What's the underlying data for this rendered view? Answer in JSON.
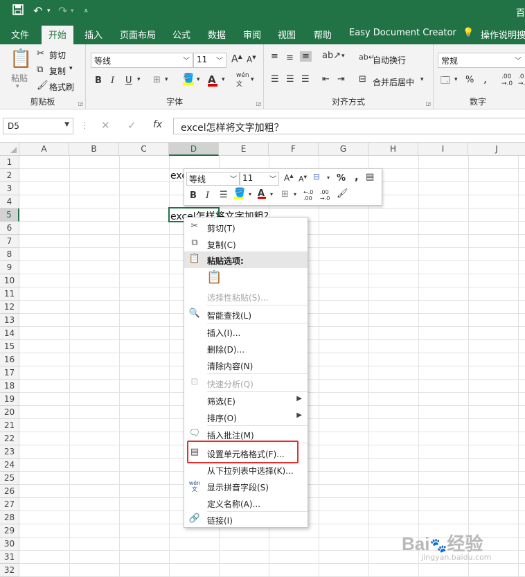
{
  "window": {
    "title_fragment": "百"
  },
  "quick_access": {
    "save": "save-icon",
    "undo": "undo-icon",
    "redo": "redo-icon",
    "customize": "customize-icon"
  },
  "ribbon_tabs": [
    "文件",
    "开始",
    "插入",
    "页面布局",
    "公式",
    "数据",
    "审阅",
    "视图",
    "帮助",
    "Easy Document Creator",
    "操作说明搜"
  ],
  "active_tab": "开始",
  "clipboard": {
    "paste": "粘贴",
    "cut": "剪切",
    "copy": "复制",
    "format_painter": "格式刷",
    "label": "剪贴板"
  },
  "font_group": {
    "font_name": "等线",
    "font_size": "11",
    "grow": "A",
    "shrink": "A",
    "bold": "B",
    "italic": "I",
    "underline": "U",
    "phonetic": "wén",
    "label": "字体"
  },
  "align_group": {
    "wrap_text": "自动换行",
    "merge_center": "合并后居中",
    "label": "对齐方式"
  },
  "number_group": {
    "format": "常规",
    "percent": "%",
    "comma": ",",
    "label": "数字"
  },
  "formula_bar": {
    "name_box": "D5",
    "fx": "fx",
    "formula": "excel怎样将文字加粗？"
  },
  "columns": [
    "A",
    "B",
    "C",
    "D",
    "E",
    "F",
    "G",
    "H",
    "I",
    "J"
  ],
  "rows": [
    "1",
    "2",
    "3",
    "4",
    "5",
    "6",
    "7",
    "8",
    "9",
    "10",
    "11",
    "12",
    "13",
    "14",
    "15",
    "16",
    "17",
    "18",
    "19",
    "20",
    "21",
    "22",
    "23",
    "24",
    "25",
    "26",
    "27",
    "28",
    "29",
    "30",
    "31",
    "32"
  ],
  "cells": {
    "d2": "exc",
    "d5": "excel怎样将文字加粗？"
  },
  "mini_toolbar": {
    "font_name": "等线",
    "font_size": "11",
    "bold": "B",
    "italic": "I",
    "percent": "%",
    "comma": ","
  },
  "context_menu": {
    "cut": "剪切(T)",
    "copy": "复制(C)",
    "paste_options": "粘贴选项:",
    "paste_special": "选择性粘贴(S)...",
    "smart_lookup": "智能查找(L)",
    "insert": "插入(I)...",
    "delete": "删除(D)...",
    "clear": "清除内容(N)",
    "quick_analysis": "快速分析(Q)",
    "filter": "筛选(E)",
    "sort": "排序(O)",
    "insert_comment": "插入批注(M)",
    "format_cells": "设置单元格格式(F)...",
    "pick_from_list": "从下拉列表中选择(K)...",
    "show_phonetic": "显示拼音字段(S)",
    "define_name": "定义名称(A)...",
    "link": "链接(I)"
  },
  "watermark": {
    "brand": "Bai",
    "brand2": "经验",
    "url": "jingyan.baidu.com"
  },
  "colors": {
    "excel_green": "#217346",
    "highlight_red": "#e03030"
  }
}
